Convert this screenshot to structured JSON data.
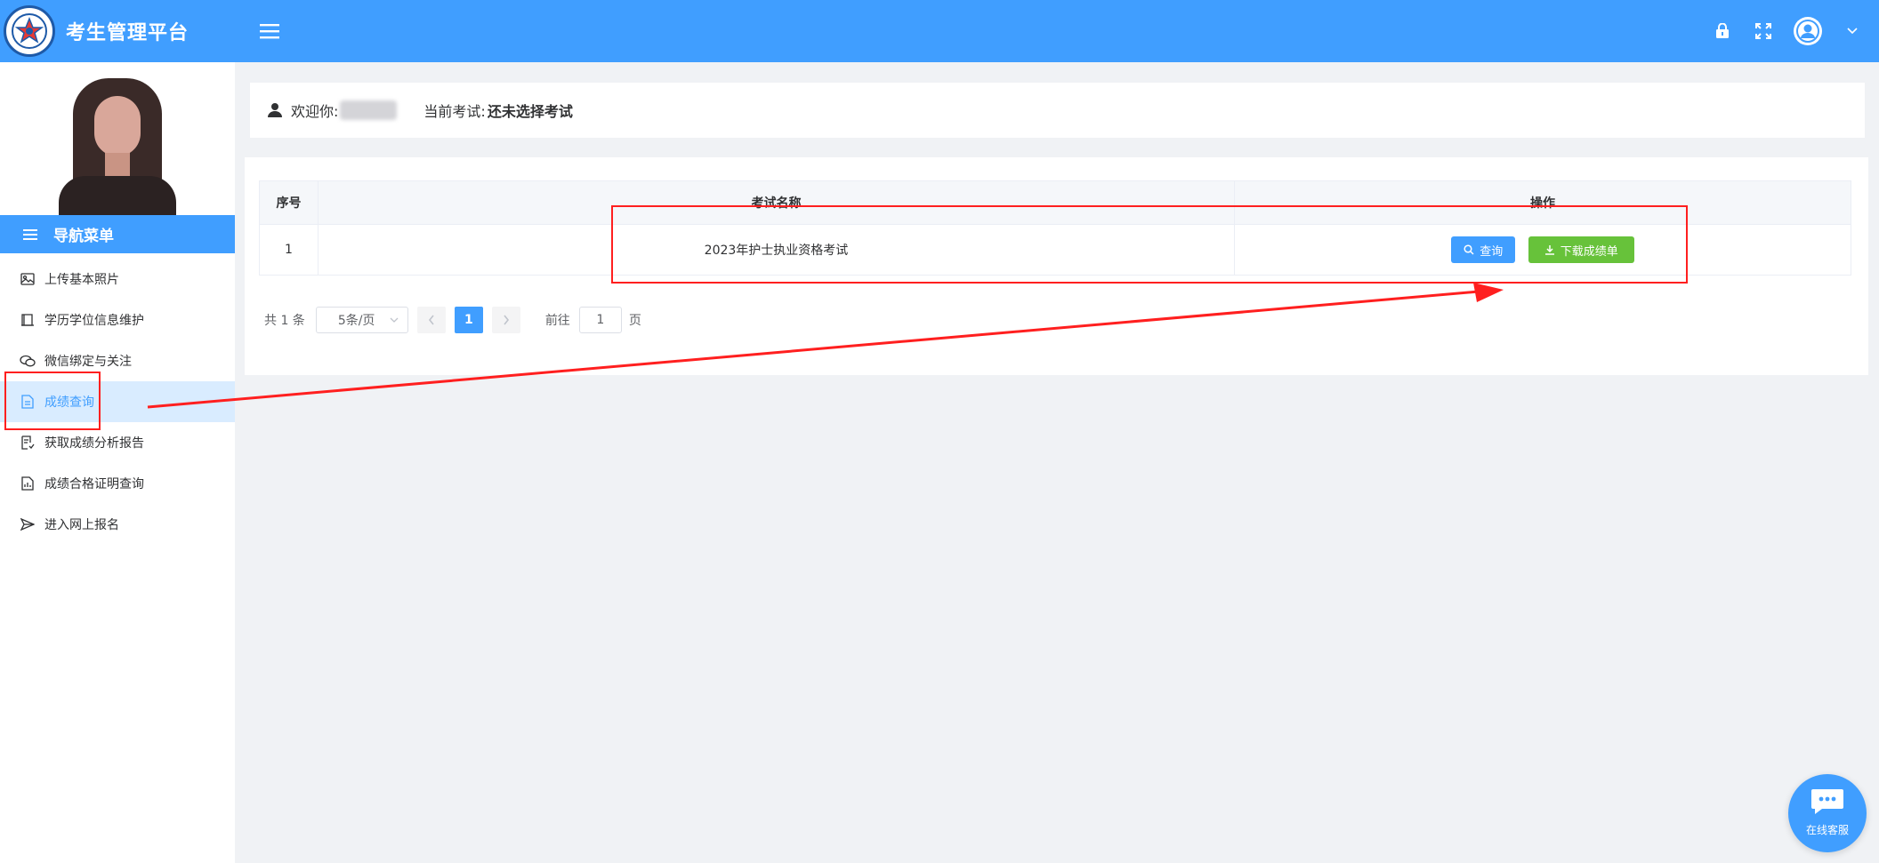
{
  "header": {
    "app_title": "考生管理平台",
    "menu_toggle_icon": "hamburger-icon",
    "right_icons": [
      "lock-icon",
      "fullscreen-icon",
      "user-avatar-icon",
      "chevron-down-icon"
    ]
  },
  "sidebar": {
    "nav_title": "导航菜单",
    "items": [
      {
        "label": "上传基本照片",
        "icon": "image-icon",
        "active": false
      },
      {
        "label": "学历学位信息维护",
        "icon": "book-icon",
        "active": false
      },
      {
        "label": "微信绑定与关注",
        "icon": "wechat-icon",
        "active": false
      },
      {
        "label": "成绩查询",
        "icon": "document-icon",
        "active": true
      },
      {
        "label": "获取成绩分析报告",
        "icon": "report-icon",
        "active": false
      },
      {
        "label": "成绩合格证明查询",
        "icon": "certificate-icon",
        "active": false
      },
      {
        "label": "进入网上报名",
        "icon": "send-icon",
        "active": false
      }
    ]
  },
  "welcome": {
    "greeting": "欢迎你:",
    "current_exam_label": "当前考试:",
    "current_exam_value": "还未选择考试"
  },
  "table": {
    "headers": [
      "序号",
      "考试名称",
      "操作"
    ],
    "rows": [
      {
        "index": "1",
        "exam_name": "2023年护士执业资格考试"
      }
    ],
    "query_button": "查询",
    "download_button": "下载成绩单"
  },
  "pagination": {
    "total": "共 1 条",
    "page_size": "5条/页",
    "current_page": "1",
    "goto_label": "前往",
    "goto_value": "1",
    "page_unit": "页"
  },
  "chat": {
    "label": "在线客服"
  },
  "colors": {
    "primary": "#409eff",
    "success": "#67c23a",
    "annotation": "#ff1f1f"
  }
}
